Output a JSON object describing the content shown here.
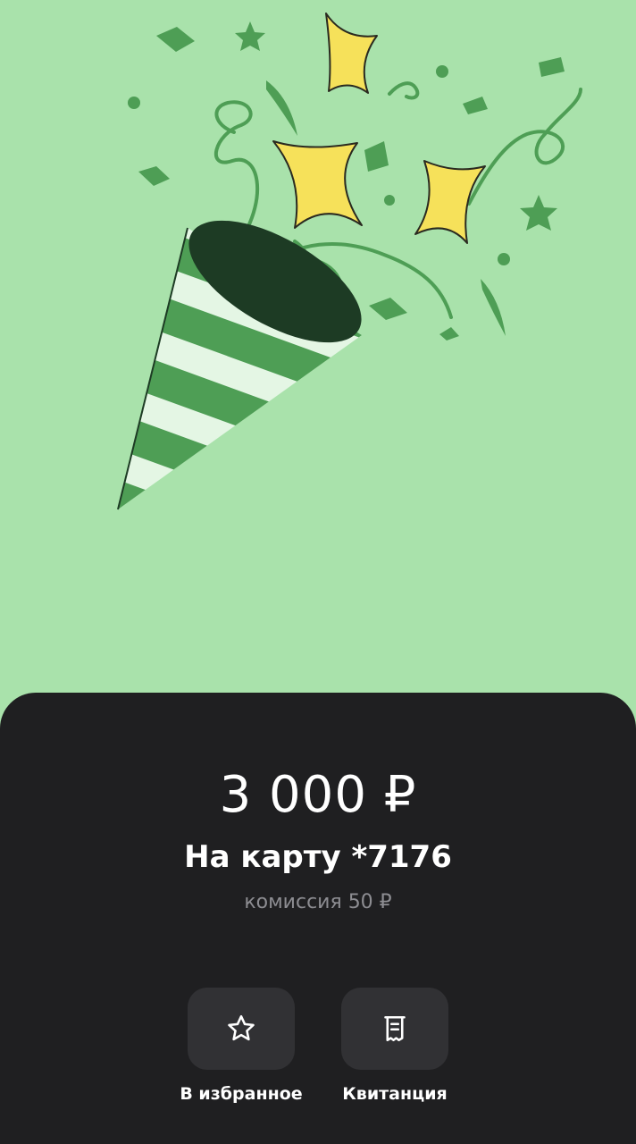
{
  "hero": {
    "illustration": "party-popper-illustration",
    "background_color": "#a9e2ab"
  },
  "payment": {
    "amount": "3 000 ₽",
    "destination": "На карту *7176",
    "fee": "комиссия 50 ₽"
  },
  "actions": [
    {
      "label": "В избранное",
      "icon": "star-icon"
    },
    {
      "label": "Квитанция",
      "icon": "receipt-icon"
    }
  ],
  "colors": {
    "sheet_background": "#1f1f21",
    "button_background": "#313134",
    "secondary_text": "#8d8d92"
  }
}
